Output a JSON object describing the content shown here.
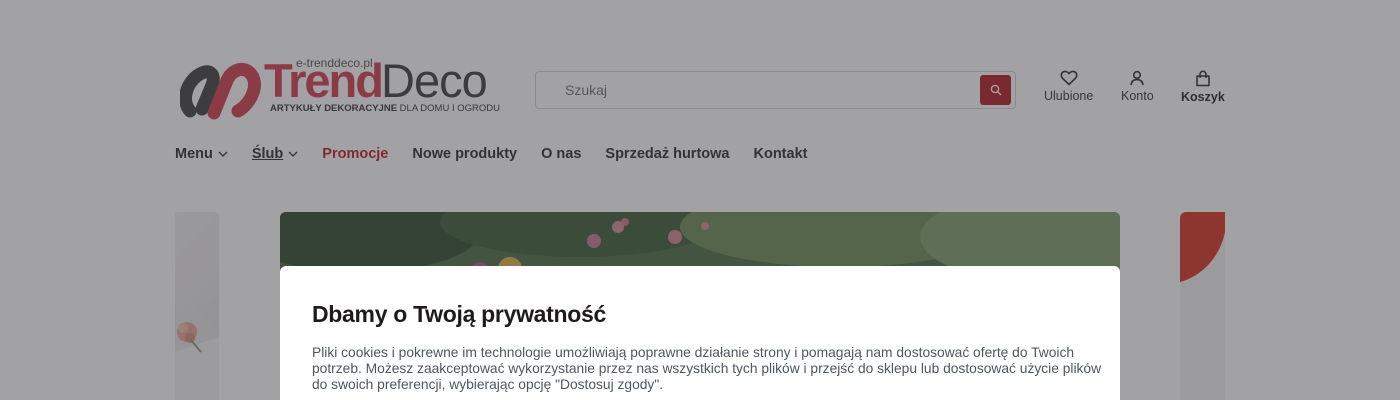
{
  "header": {
    "logo": {
      "domain": "e-trenddeco.pl",
      "brand_part1": "Trend",
      "brand_part2": "Deco",
      "tagline_bold": "ARTYKUŁY DEKORACYJNE",
      "tagline_rest": " DLA DOMU I OGRODU"
    },
    "search": {
      "placeholder": "Szukaj"
    },
    "icons": [
      {
        "label": "Ulubione",
        "icon": "heart-icon"
      },
      {
        "label": "Konto",
        "icon": "user-icon"
      },
      {
        "label": "Koszyk",
        "icon": "bag-icon"
      }
    ]
  },
  "nav": {
    "items": [
      {
        "label": "Menu",
        "has_dropdown": true
      },
      {
        "label": "Ślub",
        "has_dropdown": true
      },
      {
        "label": "Promocje"
      },
      {
        "label": "Nowe produkty"
      },
      {
        "label": "O nas"
      },
      {
        "label": "Sprzedaż hurtowa"
      },
      {
        "label": "Kontakt"
      }
    ]
  },
  "cookie_modal": {
    "title": "Dbamy o Twoją prywatność",
    "text": "Pliki cookies i pokrewne im technologie umożliwiają poprawne działanie strony i pomagają nam dostosować ofertę do Twoich potrzeb. Możesz zaakceptować wykorzystanie przez nas wszystkich tych plików i przejść do sklepu lub dostosować użycie plików do swoich preferencji, wybierając opcję \"Dostosuj zgody\"."
  },
  "colors": {
    "brand_red": "#c0161c",
    "logo_red": "#d23a4a",
    "overlay": "rgba(60,60,66,0.48)"
  }
}
